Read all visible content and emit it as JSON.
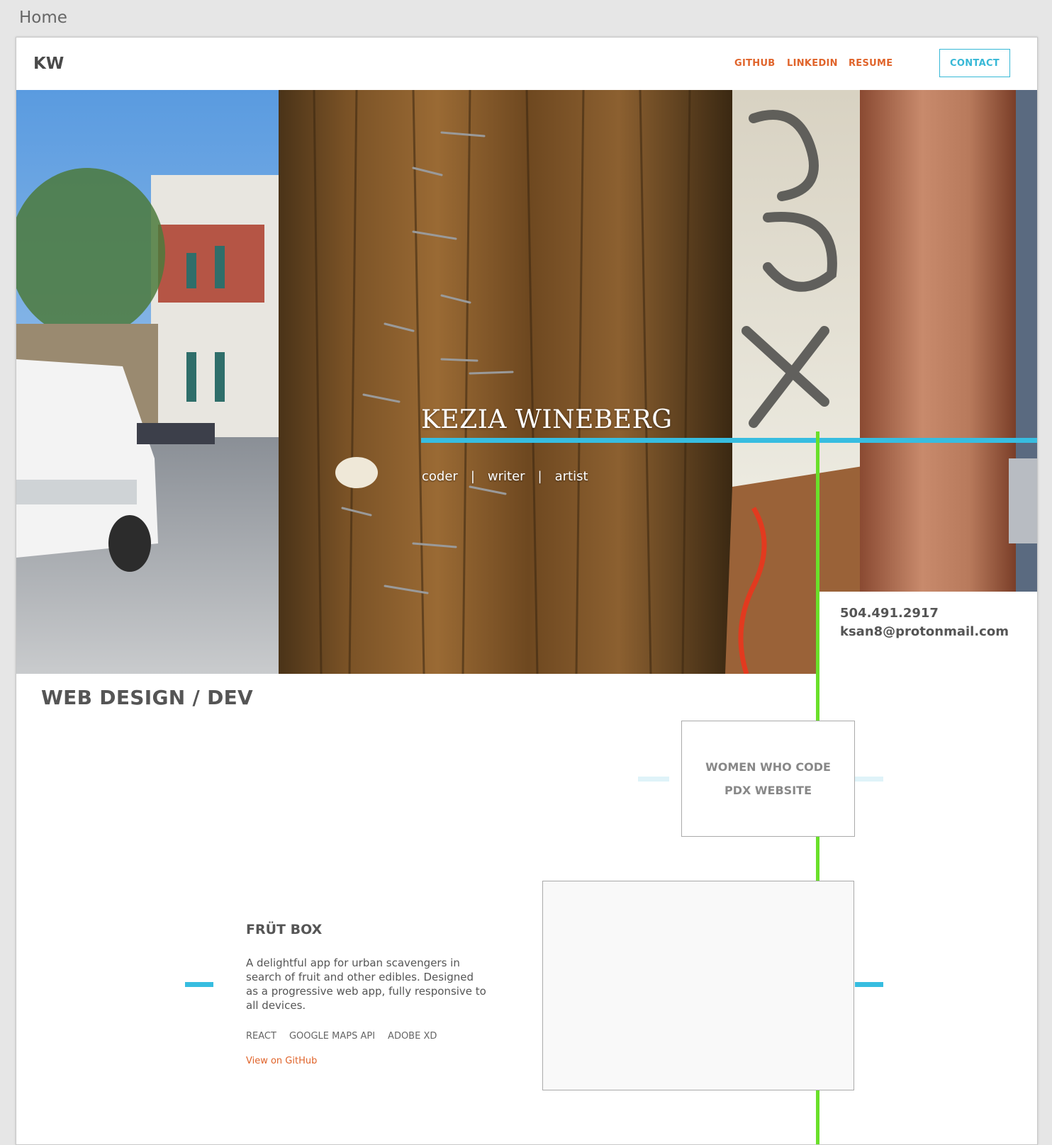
{
  "window": {
    "title": "Home"
  },
  "nav": {
    "logo": "KW",
    "links": [
      "GITHUB",
      "LINKEDIN",
      "RESUME"
    ],
    "contact_label": "CONTACT"
  },
  "hero": {
    "name": "KEZIA WINEBERG",
    "roles": [
      "coder",
      "writer",
      "artist"
    ],
    "separator": "|"
  },
  "contact": {
    "phone": "504.491.2917",
    "email": "ksan8@protonmail.com"
  },
  "section": {
    "title": "WEB DESIGN / DEV"
  },
  "projects": [
    {
      "title": "WOMEN WHO CODE PDX WEBSITE"
    },
    {
      "title": "FRÜT BOX",
      "description": "A delightful app for urban scavengers in search of fruit and other edibles. Designed as a progressive web app, fully responsive to all devices.",
      "tags": [
        "REACT",
        "GOOGLE MAPS API",
        "ADOBE XD"
      ],
      "link": "View on GitHub"
    }
  ],
  "colors": {
    "accent_orange": "#e0642b",
    "accent_blue": "#37bde0",
    "timeline_green": "#6ae02a"
  }
}
